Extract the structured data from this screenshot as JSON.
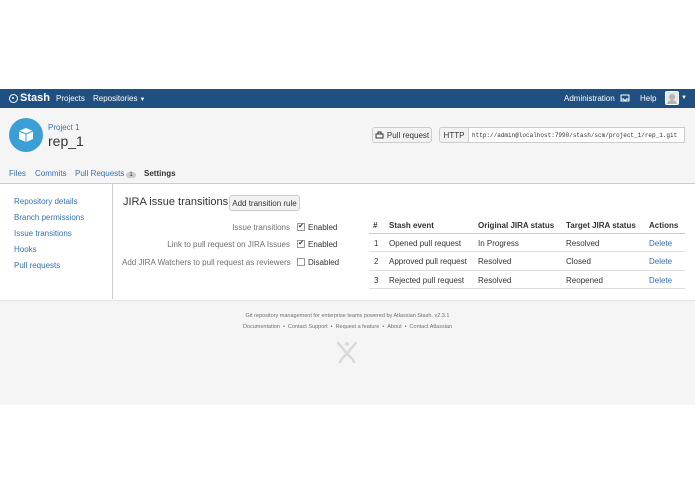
{
  "app": {
    "brand": "Stash",
    "colors": {
      "nav_bg": "#205081",
      "link": "#3572b0",
      "repo_avatar": "#3b9fd5"
    }
  },
  "topnav": {
    "projects": "Projects",
    "repositories": "Repositories",
    "administration": "Administration",
    "help": "Help"
  },
  "header": {
    "project": "Project 1",
    "repo": "rep_1",
    "pull_request_btn": "Pull request",
    "protocol": "HTTP",
    "clone_url": "http://admin@localhost:7990/stash/scm/project_1/rep_1.git"
  },
  "tabs": {
    "files": "Files",
    "commits": "Commits",
    "pull_requests": "Pull Requests",
    "pull_requests_count": "1",
    "settings": "Settings"
  },
  "sidebar": {
    "items": [
      "Repository details",
      "Branch permissions",
      "Issue transitions",
      "Hooks",
      "Pull requests"
    ]
  },
  "main": {
    "title": "JIRA issue transitions",
    "add_rule": "Add transition rule",
    "settings": [
      {
        "label": "Issue transitions",
        "checked": true,
        "value": "Enabled"
      },
      {
        "label": "Link to pull request on JIRA Issues",
        "checked": true,
        "value": "Enabled"
      },
      {
        "label": "Add JIRA Watchers to pull request as reviewers",
        "checked": false,
        "value": "Disabled"
      }
    ],
    "table": {
      "headers": [
        "#",
        "Stash event",
        "Original JIRA status",
        "Target JIRA status",
        "Actions"
      ],
      "rows": [
        {
          "num": "1",
          "event": "Opened pull request",
          "original": "In Progress",
          "target": "Resolved",
          "action": "Delete"
        },
        {
          "num": "2",
          "event": "Approved pull request",
          "original": "Resolved",
          "target": "Closed",
          "action": "Delete"
        },
        {
          "num": "3",
          "event": "Rejected pull request",
          "original": "Resolved",
          "target": "Reopened",
          "action": "Delete"
        }
      ]
    }
  },
  "footer": {
    "tagline": "Git repository management for enterprise teams powered by Atlassian Stash. v2.3.1",
    "links": [
      "Documentation",
      "Contact Support",
      "Request a feature",
      "About",
      "Contact Atlassian"
    ]
  }
}
